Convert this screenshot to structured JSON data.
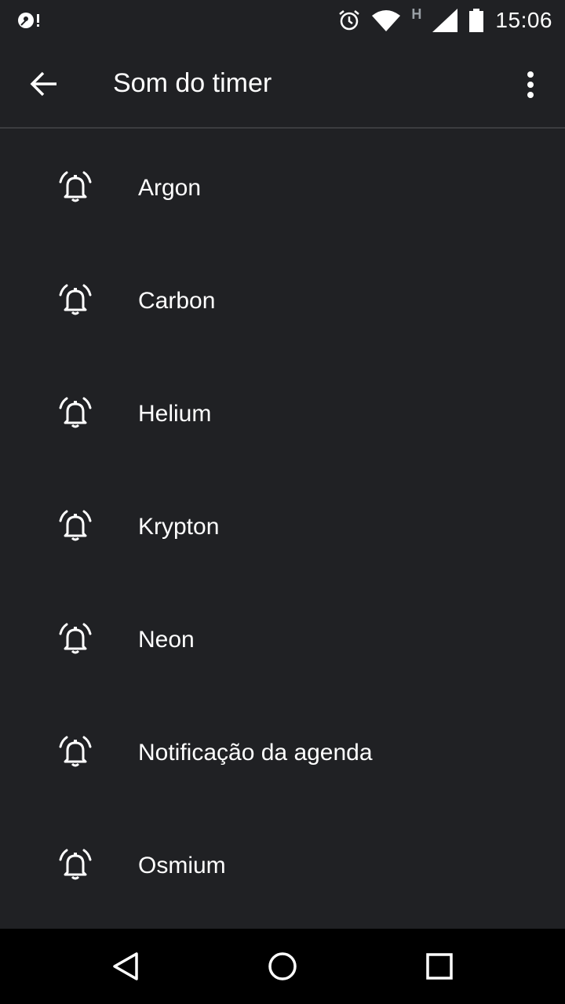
{
  "status_bar": {
    "time": "15:06",
    "network_type": "H",
    "icons": [
      "media-notification-icon",
      "alarm-icon",
      "wifi-icon",
      "signal-icon",
      "battery-icon"
    ]
  },
  "app_bar": {
    "title": "Som do timer",
    "back_icon": "arrow-back-icon",
    "overflow_icon": "more-vert-icon"
  },
  "sounds": [
    {
      "label": "Argon",
      "icon": "alarm-bell-icon"
    },
    {
      "label": "Carbon",
      "icon": "alarm-bell-icon"
    },
    {
      "label": "Helium",
      "icon": "alarm-bell-icon"
    },
    {
      "label": "Krypton",
      "icon": "alarm-bell-icon"
    },
    {
      "label": "Neon",
      "icon": "alarm-bell-icon"
    },
    {
      "label": "Notificação da agenda",
      "icon": "alarm-bell-icon"
    },
    {
      "label": "Osmium",
      "icon": "alarm-bell-icon"
    }
  ],
  "nav_bar": {
    "buttons": [
      "back-triangle-icon",
      "home-circle-icon",
      "recents-square-icon"
    ]
  },
  "colors": {
    "background": "#202124",
    "text": "#ffffff",
    "divider": "#3c3d40",
    "nav_background": "#000000"
  }
}
